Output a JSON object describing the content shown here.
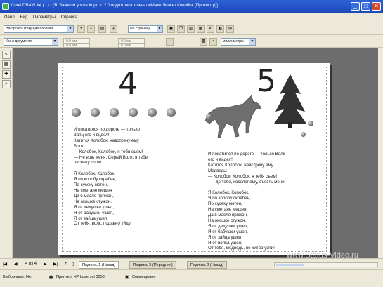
{
  "window": {
    "title": "Corel DRAW X4 (...) - [Я: Заметки урока Корд v12.0 подготовка к печати\\Макет\\Макет Колобок (Просмотр)]",
    "min": "_",
    "max": "□",
    "close": "✕"
  },
  "menu": [
    "Файл",
    "Вид",
    "Параметры",
    "Справка"
  ],
  "toolbar1": {
    "preset": "Настройка (текущие парамет...",
    "pages": "По странице"
  },
  "toolbar2": {
    "position": "Как в документе",
    "field1": "0.0 мм",
    "field2": "0.0 мм",
    "field3": "0.0 мм",
    "field4": "0.0 мм",
    "units": "миллиметры"
  },
  "page": {
    "num_left": "4",
    "num_right": "5",
    "poem_left": "И покатился по дороге — только\nЗаяц его и видел!\nКатится Колобок, навстречу ему\nВолк:\n— Колобок, Колобок, я тебя съем!\n— Не ешь меня, Серый Волк, я тебе\nпесенку спою:\n\nЯ Колобок, Колобок,\nЯ по коробу скребен,\nПо сусеку метен,\nНа сметане мешен\nДа в масле пряжон,\nНа окошке стужон.\nЯ от дедушки ушел,\nЯ от бабушки ушел,\nЯ от зайца ушел,\nОт тебя, волк, подавно уйду!",
    "poem_right": "И покатился по дороге — только Волк\nего и видел!\nКатится Колобок, навстречу ему\nМедведь:\n— Колобок, Колобок, я тебя съем!\n— Где тебе, косолапому, съесть меня!\n\nЯ Колобок, Колобок,\nЯ по коробу скребен,\nПо сусеку метен,\nНа сметане мешен\nДа в масле пряжон,\nНа окошке стужон.\nЯ от дедушки ушел,\nЯ от бабушки ушел,\nЯ от зайца ушел,\nЯ от волка ушел,\nОт тебя, медведь, не хитро уйти!"
  },
  "watermark": "www.Status-Video.ru",
  "pager": {
    "counter": "4 из 4",
    "tabs": [
      "Подпись 1 (Назад)",
      "Подпись 2 (Передняя)",
      "Подпись 2 (Назад)"
    ]
  },
  "status": {
    "selected": "Выбранные: Нет",
    "printer_label": "Принтер: HP LaserJet 3050",
    "mode": "Совмещение"
  }
}
